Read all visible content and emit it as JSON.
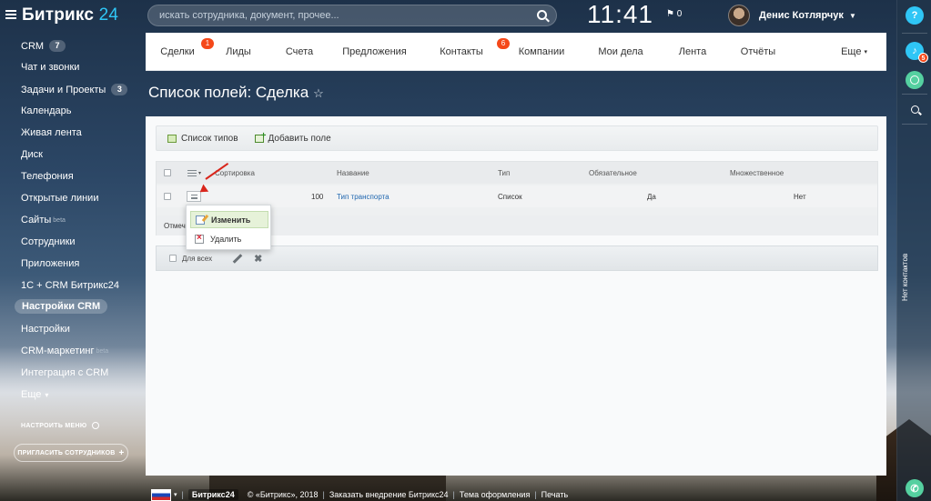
{
  "header": {
    "logo_text": "Битрикс",
    "logo_num": "24",
    "search_placeholder": "искать сотрудника, документ, прочее...",
    "clock": "11:41",
    "flag_count": "0",
    "user_name": "Денис Котлярчук"
  },
  "sidebar": {
    "items": [
      {
        "label": "CRM",
        "counter": "7"
      },
      {
        "label": "Чат и звонки"
      },
      {
        "label": "Задачи и Проекты",
        "counter": "3"
      },
      {
        "label": "Календарь"
      },
      {
        "label": "Живая лента"
      },
      {
        "label": "Диск"
      },
      {
        "label": "Телефония"
      },
      {
        "label": "Открытые линии"
      },
      {
        "label": "Сайты",
        "sup": "beta"
      },
      {
        "label": "Сотрудники"
      },
      {
        "label": "Приложения"
      },
      {
        "label": "1С + CRM Битрикс24"
      },
      {
        "label": "Настройки CRM",
        "active": true
      },
      {
        "label": "Настройки"
      },
      {
        "label": "CRM-маркетинг",
        "sup": "beta"
      },
      {
        "label": "Интеграция с CRM"
      },
      {
        "label": "Еще"
      }
    ],
    "setup_menu": "НАСТРОИТЬ МЕНЮ",
    "invite_button": "ПРИГЛАСИТЬ СОТРУДНИКОВ"
  },
  "right_panel": {
    "help": "?",
    "notif_badge": "5",
    "recent_label": "Нет контактов"
  },
  "tabs": [
    {
      "label": "Сделки",
      "badge": "1"
    },
    {
      "label": "Лиды"
    },
    {
      "label": "Счета"
    },
    {
      "label": "Предложения"
    },
    {
      "label": "Контакты",
      "badge": "6"
    },
    {
      "label": "Компании"
    },
    {
      "label": "Мои дела"
    },
    {
      "label": "Лента"
    },
    {
      "label": "Отчёты"
    },
    {
      "label": "Еще"
    }
  ],
  "page": {
    "title": "Список полей: Сделка",
    "star": "☆"
  },
  "toolbar": {
    "type_list": "Список типов",
    "add_field": "Добавить поле"
  },
  "grid": {
    "columns": {
      "sort": "Сортировка",
      "name": "Название",
      "type": "Тип",
      "required": "Обязательное",
      "multiple": "Множественное"
    },
    "rows": [
      {
        "sort": "100",
        "name": "Тип транспорта",
        "type": "Список",
        "required": "Да",
        "multiple": "Нет"
      }
    ],
    "footer_label": "Отмеч"
  },
  "action_bar": {
    "for_all": "Для всех"
  },
  "context_menu": {
    "edit": "Изменить",
    "delete": "Удалить"
  },
  "footer": {
    "logo": "Битрикс24",
    "copyright": "© «Битрикс», 2018",
    "order": "Заказать внедрение Битрикс24",
    "theme": "Тема оформления",
    "print": "Печать"
  }
}
